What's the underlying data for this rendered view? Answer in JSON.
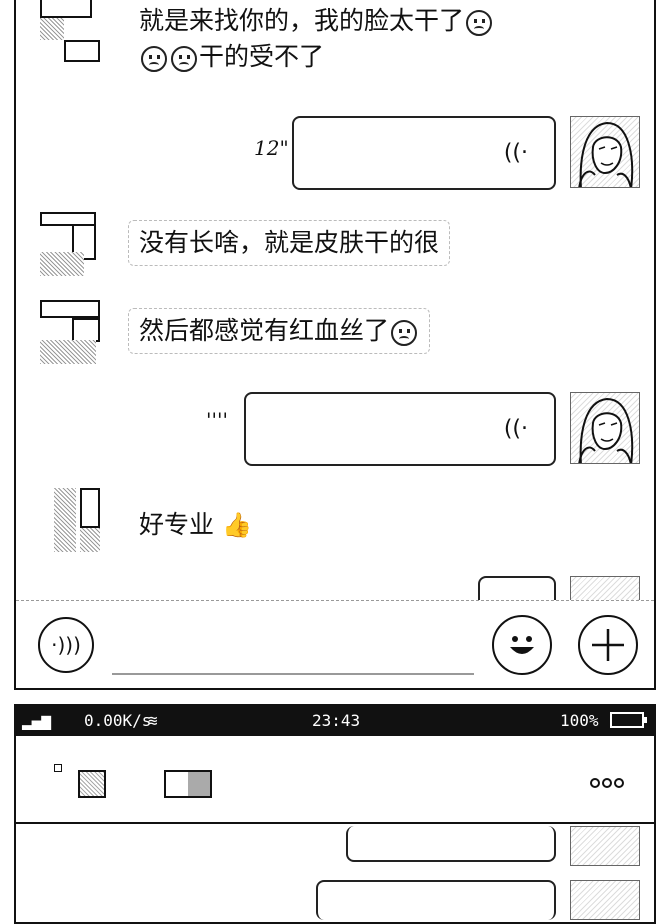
{
  "chat_top": {
    "messages": [
      {
        "side": "left",
        "type": "text",
        "text_line1": "就是来找你的，我的脸太干了",
        "text_line2": "干的受不了"
      },
      {
        "side": "right",
        "type": "voice",
        "duration": "12\""
      },
      {
        "side": "left",
        "type": "text",
        "text": "没有长啥，就是皮肤干的很"
      },
      {
        "side": "left",
        "type": "text",
        "text": "然后都感觉有红血丝了"
      },
      {
        "side": "right",
        "type": "voice",
        "duration": "''''"
      },
      {
        "side": "left",
        "type": "text",
        "text": "好专业"
      }
    ],
    "input": {
      "voice_icon": "voice-icon",
      "emoji_icon": "smiley-icon",
      "plus_icon": "plus-icon",
      "value": ""
    }
  },
  "status_bar": {
    "signal": "4G",
    "network_speed": "0.00K/s",
    "time": "23:43",
    "battery": "100%"
  },
  "chat_bottom": {
    "more_icon": "more-dots-icon"
  }
}
